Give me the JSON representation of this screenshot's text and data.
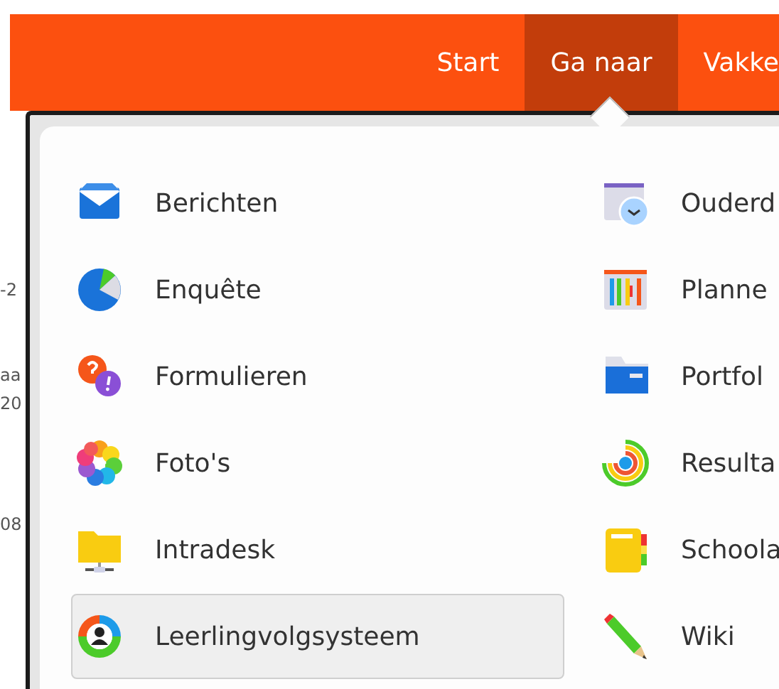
{
  "navbar": {
    "items": [
      {
        "label": "Start",
        "selected": false
      },
      {
        "label": "Ga naar",
        "selected": true
      },
      {
        "label": "Vakke",
        "selected": false
      }
    ]
  },
  "background_fragments": [
    "-2",
    "aa",
    "20",
    "08"
  ],
  "menu": {
    "columns": [
      [
        {
          "label": "Berichten",
          "kind": "mail",
          "selected": false
        },
        {
          "label": "Enquête",
          "kind": "pie",
          "selected": false
        },
        {
          "label": "Formulieren",
          "kind": "questions",
          "selected": false
        },
        {
          "label": "Foto's",
          "kind": "flower",
          "selected": false
        },
        {
          "label": "Intradesk",
          "kind": "netfolder",
          "selected": false
        },
        {
          "label": "Leerlingvolgsysteem",
          "kind": "person",
          "selected": true
        }
      ],
      [
        {
          "label": "Ouderd",
          "kind": "calclock",
          "selected": false
        },
        {
          "label": "Planne",
          "kind": "planner",
          "selected": false
        },
        {
          "label": "Portfol",
          "kind": "folder",
          "selected": false
        },
        {
          "label": "Resulta",
          "kind": "target",
          "selected": false
        },
        {
          "label": "Schoola",
          "kind": "notebook",
          "selected": false
        },
        {
          "label": "Wiki",
          "kind": "pencil",
          "selected": false
        }
      ]
    ]
  }
}
